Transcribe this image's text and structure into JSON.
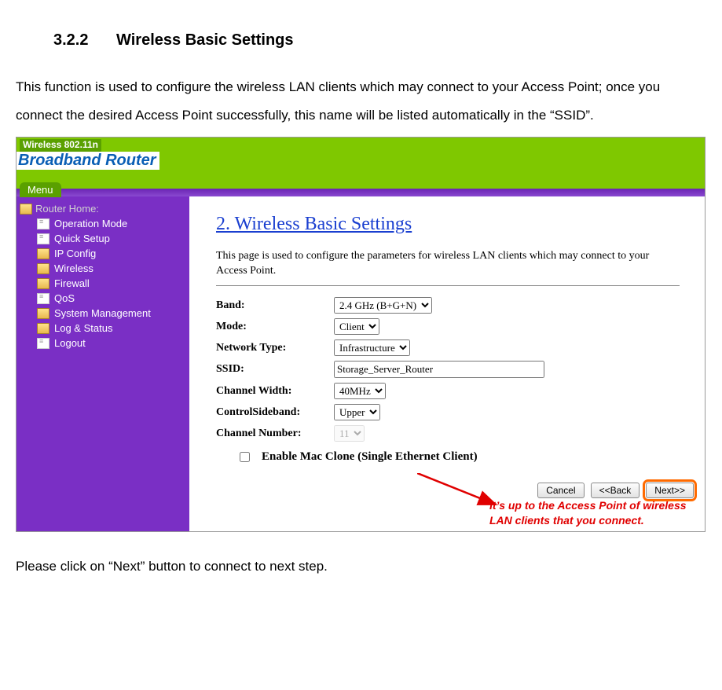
{
  "doc": {
    "section_number": "3.2.2",
    "section_title": "Wireless Basic Settings",
    "intro": "This function is used to configure the wireless LAN clients which may connect to your Access Point; once you connect the desired Access Point successfully, this name will be listed automatically in the “SSID”.",
    "footer": "Please click on “Next” button to connect to next step."
  },
  "router_ui": {
    "topbar_tag": "Wireless 802.11n",
    "brand": "Broadband Router",
    "menu_tab": "Menu",
    "sidebar": {
      "root": "Router Home:",
      "items": [
        {
          "label": "Operation Mode",
          "icon": "page"
        },
        {
          "label": "Quick Setup",
          "icon": "page"
        },
        {
          "label": "IP Config",
          "icon": "folder"
        },
        {
          "label": "Wireless",
          "icon": "folder"
        },
        {
          "label": "Firewall",
          "icon": "folder"
        },
        {
          "label": "QoS",
          "icon": "page"
        },
        {
          "label": "System Management",
          "icon": "folder"
        },
        {
          "label": "Log & Status",
          "icon": "folder"
        },
        {
          "label": "Logout",
          "icon": "page"
        }
      ]
    },
    "content": {
      "title": "2. Wireless Basic Settings",
      "description": "This page is used to configure the parameters for wireless LAN clients which may connect to your Access Point.",
      "fields": {
        "band_label": "Band:",
        "band_value": "2.4 GHz (B+G+N)",
        "mode_label": "Mode:",
        "mode_value": "Client",
        "nettype_label": "Network Type:",
        "nettype_value": "Infrastructure",
        "ssid_label": "SSID:",
        "ssid_value": "Storage_Server_Router",
        "chwidth_label": "Channel Width:",
        "chwidth_value": "40MHz",
        "ctrlsb_label": "ControlSideband:",
        "ctrlsb_value": "Upper",
        "chnum_label": "Channel Number:",
        "chnum_value": "11",
        "macclone_label": "Enable Mac Clone (Single Ethernet Client)"
      },
      "buttons": {
        "cancel": "Cancel",
        "back": "<<Back",
        "next": "Next>>"
      }
    },
    "annotation": "It’s up to the Access Point of wireless LAN clients that you connect."
  }
}
